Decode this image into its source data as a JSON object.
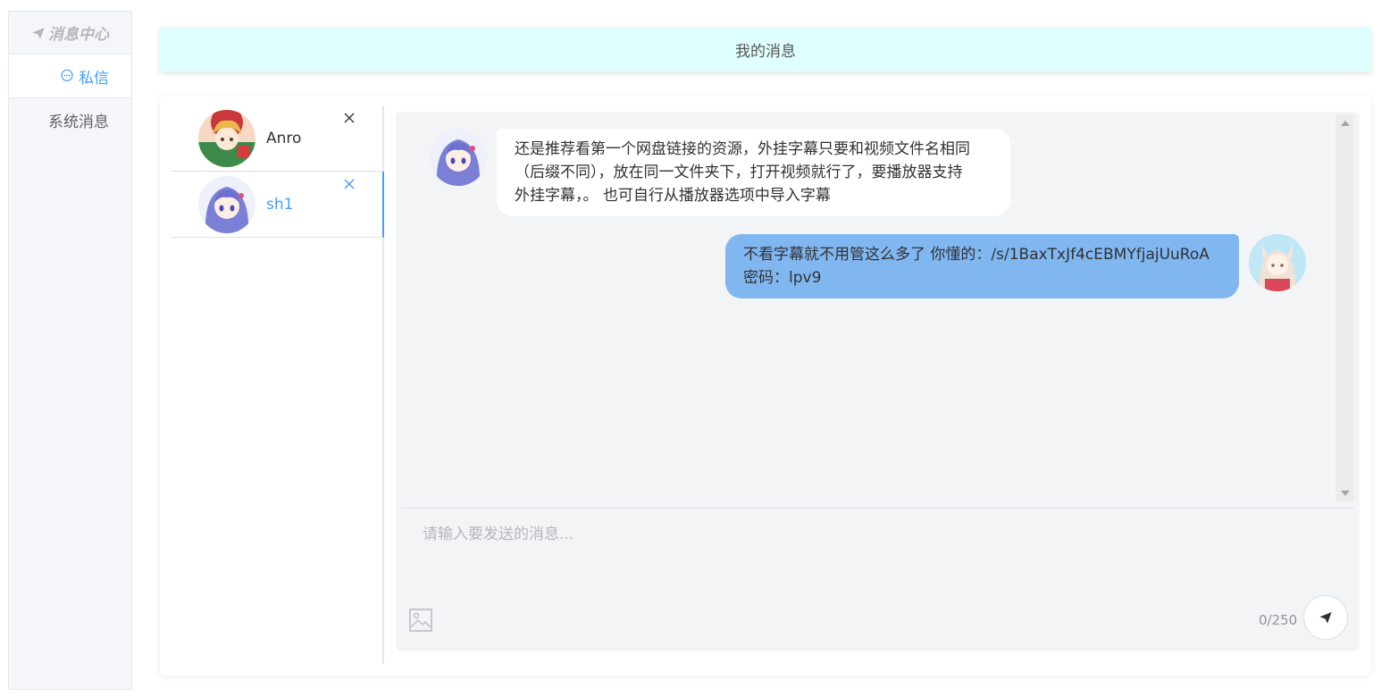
{
  "sidebar": {
    "title": "消息中心",
    "items": [
      {
        "label": "私信",
        "active": true
      },
      {
        "label": "系统消息",
        "active": false
      }
    ]
  },
  "header": {
    "title": "我的消息"
  },
  "contacts": [
    {
      "name": "Anro",
      "active": false
    },
    {
      "name": "sh1",
      "active": true
    }
  ],
  "messages": [
    {
      "direction": "in",
      "lines": [
        "还是推荐看第一个网盘链接的资源，外挂字幕只要和视频文件名相同",
        "（后缀不同），放在同一文件夹下，打开视频就行了，要播放器支持",
        "外挂字幕，。 也可自行从播放器选项中导入字幕"
      ]
    },
    {
      "direction": "out",
      "lines": [
        "不看字幕就不用管这么多了 你懂的：/s/1BaxTxJf4cEBMYfjajUuRoA",
        "密码：lpv9"
      ]
    }
  ],
  "composer": {
    "placeholder": "请输入要发送的消息...",
    "counter": "0/250"
  },
  "colors": {
    "accent": "#409eff",
    "header_bg": "#e0ffff",
    "outgoing_bubble": "#81b7f0",
    "chat_bg": "#f3f4f6"
  }
}
